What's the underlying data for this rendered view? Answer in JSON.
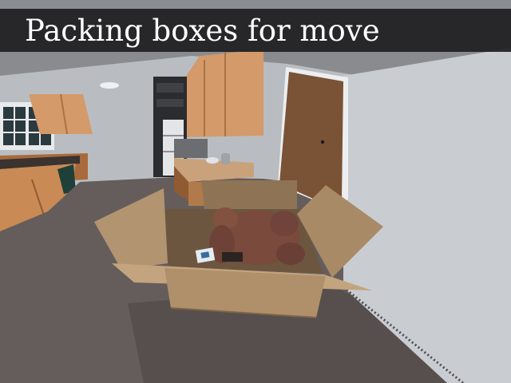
{
  "hud": {
    "objective_title": "Packing boxes for move"
  },
  "scene": {
    "description_tags": [
      "kitchen",
      "cardboard-box",
      "teddy-bear",
      "wooden-door",
      "cabinets",
      "stove",
      "wood-floor"
    ],
    "colors": {
      "floor": "#6b6260",
      "wall": "#bfc3c7",
      "cabinet": "#d49a6a",
      "door": "#7a5236",
      "box": "#b0906a",
      "bear": "#7a4a3c",
      "title_bg": "#1c1c1e"
    }
  }
}
